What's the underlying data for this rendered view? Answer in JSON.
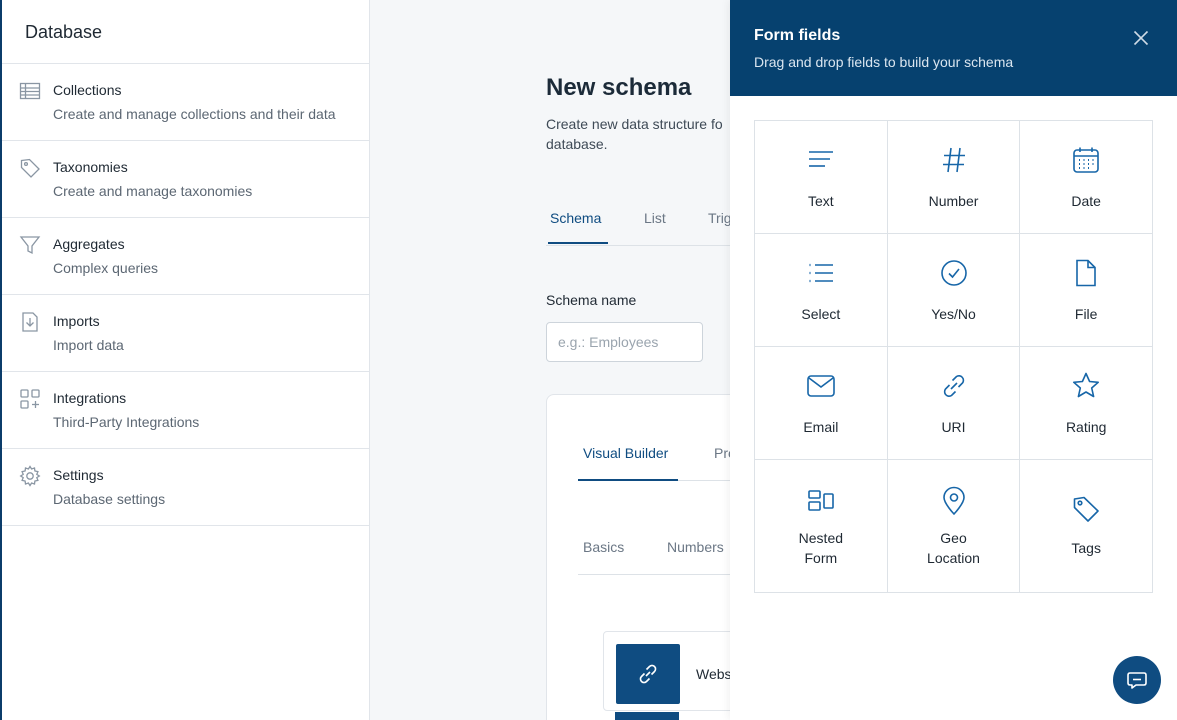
{
  "sidebar": {
    "title": "Database",
    "items": [
      {
        "label": "Collections",
        "desc": "Create and manage collections and their data",
        "icon": "table-icon"
      },
      {
        "label": "Taxonomies",
        "desc": "Create and manage taxonomies",
        "icon": "tag-icon"
      },
      {
        "label": "Aggregates",
        "desc": "Complex queries",
        "icon": "filter-icon"
      },
      {
        "label": "Imports",
        "desc": "Import data",
        "icon": "import-icon"
      },
      {
        "label": "Integrations",
        "desc": "Third-Party Integrations",
        "icon": "apps-icon"
      },
      {
        "label": "Settings",
        "desc": "Database settings",
        "icon": "gear-icon"
      }
    ]
  },
  "main": {
    "title": "New schema",
    "desc_line1": "Create new data structure fo",
    "desc_line2": "database.",
    "tabs": [
      "Schema",
      "List",
      "Trig"
    ],
    "schema_name_label": "Schema name",
    "schema_name_placeholder": "e.g.: Employees",
    "builder_tabs": [
      "Visual Builder",
      "Pre"
    ],
    "category_tabs": [
      "Basics",
      "Numbers"
    ],
    "field_row_label": "Webs"
  },
  "drawer": {
    "title": "Form fields",
    "subtitle": "Drag and drop fields to build your schema",
    "fields": [
      {
        "label": "Text",
        "icon": "text-lines-icon"
      },
      {
        "label": "Number",
        "icon": "hash-icon"
      },
      {
        "label": "Date",
        "icon": "calendar-icon"
      },
      {
        "label": "Select",
        "icon": "list-icon"
      },
      {
        "label": "Yes/No",
        "icon": "check-circle-icon"
      },
      {
        "label": "File",
        "icon": "file-icon"
      },
      {
        "label": "Email",
        "icon": "envelope-icon"
      },
      {
        "label": "URI",
        "icon": "link-icon"
      },
      {
        "label": "Rating",
        "icon": "star-icon"
      },
      {
        "label_line1": "Nested",
        "label_line2": "Form",
        "icon": "nested-form-icon"
      },
      {
        "label_line1": "Geo",
        "label_line2": "Location",
        "icon": "map-pin-icon"
      },
      {
        "label": "Tags",
        "icon": "tag-icon"
      }
    ]
  },
  "colors": {
    "accent": "#0f4c81",
    "drawer_header": "#06416f",
    "icon_blue": "#1766a8"
  }
}
